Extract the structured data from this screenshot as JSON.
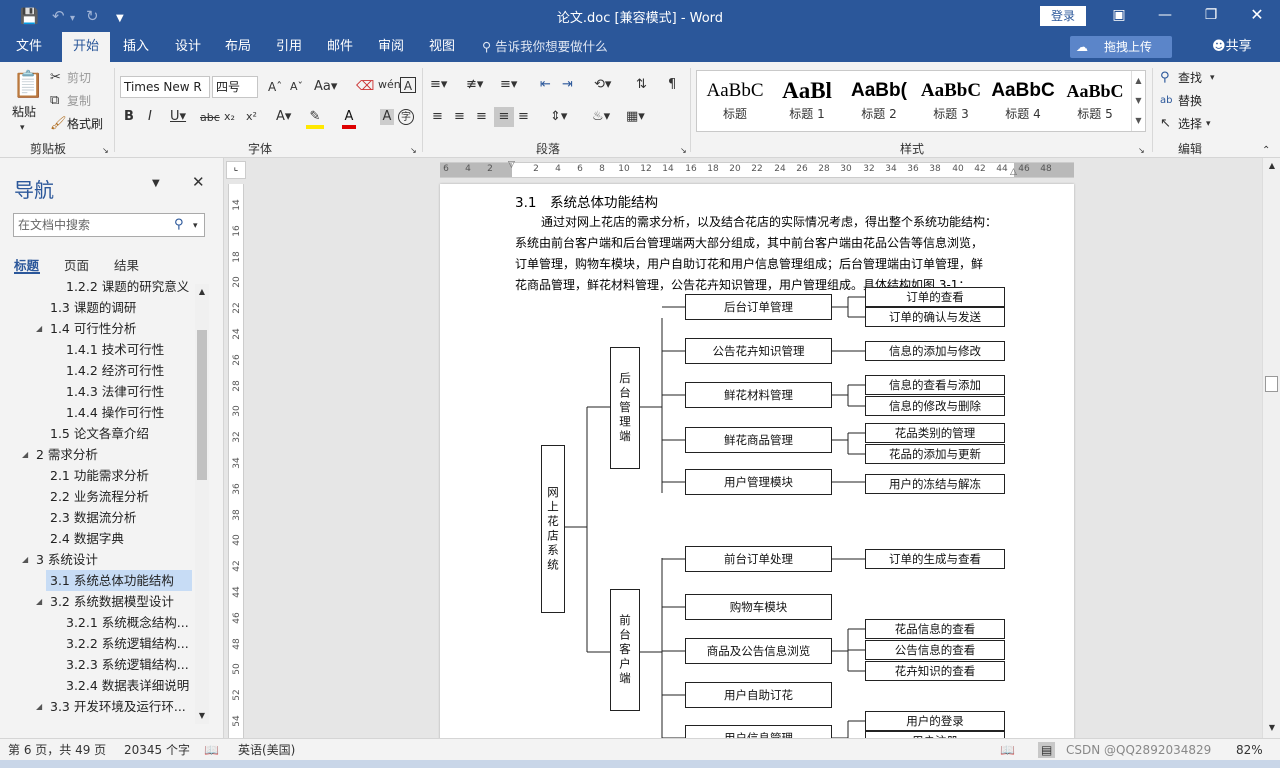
{
  "titlebar": {
    "doc_title": "论文.doc [兼容模式] - Word",
    "save_icon": "save-icon",
    "undo_icon": "undo-icon",
    "redo_icon": "redo-icon",
    "login_label": "登录"
  },
  "tabs": [
    "文件",
    "开始",
    "插入",
    "设计",
    "布局",
    "引用",
    "邮件",
    "审阅",
    "视图"
  ],
  "active_tab": "开始",
  "tell_me": "告诉我你想要做什么",
  "upload_label": "拖拽上传",
  "share_label": "共享",
  "ribbon": {
    "clipboard": {
      "paste": "粘贴",
      "cut": "剪切",
      "copy": "复制",
      "format_painter": "格式刷",
      "label": "剪贴板"
    },
    "font": {
      "name": "Times New R",
      "size": "四号",
      "label": "字体"
    },
    "paragraph": {
      "label": "段落"
    },
    "styles": {
      "label": "样式",
      "items": [
        {
          "preview": "AaBbC",
          "name": "标题"
        },
        {
          "preview": "AaBl",
          "name": "标题 1"
        },
        {
          "preview": "AaBb(",
          "name": "标题 2"
        },
        {
          "preview": "AaBbC",
          "name": "标题 3"
        },
        {
          "preview": "AaBbC",
          "name": "标题 4"
        },
        {
          "preview": "AaBbC",
          "name": "标题 5"
        }
      ]
    },
    "editing": {
      "find": "查找",
      "replace": "替换",
      "select": "选择",
      "label": "编辑"
    }
  },
  "nav": {
    "title": "导航",
    "search_placeholder": "在文档中搜索",
    "tabs": [
      "标题",
      "页面",
      "结果"
    ],
    "items": [
      {
        "num": "1.2.2",
        "text": "课题的研究意义",
        "level": 3,
        "tri": false
      },
      {
        "num": "1.3",
        "text": "课题的调研",
        "level": 2,
        "tri": false
      },
      {
        "num": "1.4",
        "text": "可行性分析",
        "level": 2,
        "tri": true
      },
      {
        "num": "1.4.1",
        "text": "技术可行性",
        "level": 3,
        "tri": false
      },
      {
        "num": "1.4.2",
        "text": "经济可行性",
        "level": 3,
        "tri": false
      },
      {
        "num": "1.4.3",
        "text": "法律可行性",
        "level": 3,
        "tri": false
      },
      {
        "num": "1.4.4",
        "text": "操作可行性",
        "level": 3,
        "tri": false
      },
      {
        "num": "1.5",
        "text": "论文各章介绍",
        "level": 2,
        "tri": false
      },
      {
        "num": "2",
        "text": "需求分析",
        "level": 1,
        "tri": true
      },
      {
        "num": "2.1",
        "text": "功能需求分析",
        "level": 2,
        "tri": false
      },
      {
        "num": "2.2",
        "text": "业务流程分析",
        "level": 2,
        "tri": false
      },
      {
        "num": "2.3",
        "text": "数据流分析",
        "level": 2,
        "tri": false
      },
      {
        "num": "2.4",
        "text": "数据字典",
        "level": 2,
        "tri": false
      },
      {
        "num": "3",
        "text": "系统设计",
        "level": 1,
        "tri": true
      },
      {
        "num": "3.1",
        "text": "系统总体功能结构",
        "level": 2,
        "tri": false,
        "selected": true
      },
      {
        "num": "3.2",
        "text": "系统数据模型设计",
        "level": 2,
        "tri": true
      },
      {
        "num": "3.2.1",
        "text": "系统概念结构...",
        "level": 3,
        "tri": false
      },
      {
        "num": "3.2.2",
        "text": "系统逻辑结构...",
        "level": 3,
        "tri": false
      },
      {
        "num": "3.2.3",
        "text": "系统逻辑结构...",
        "level": 3,
        "tri": false
      },
      {
        "num": "3.2.4",
        "text": "数据表详细说明",
        "level": 3,
        "tri": false
      },
      {
        "num": "3.3",
        "text": "开发环境及运行环...",
        "level": 2,
        "tri": true
      }
    ]
  },
  "ruler": {
    "h_ticks": [
      "6",
      "4",
      "2",
      "2",
      "4",
      "6",
      "8",
      "10",
      "12",
      "14",
      "16",
      "18",
      "20",
      "22",
      "24",
      "26",
      "28",
      "30",
      "32",
      "34",
      "36",
      "38",
      "40",
      "42",
      "44",
      "46",
      "48"
    ],
    "v_ticks": [
      "14",
      "16",
      "18",
      "20",
      "22",
      "24",
      "26",
      "28",
      "30",
      "32",
      "34",
      "36",
      "38",
      "40",
      "42",
      "44",
      "46",
      "48",
      "50",
      "52",
      "54"
    ]
  },
  "document": {
    "section_title": "3.1　系统总体功能结构",
    "paragraph_lines": [
      "通过对网上花店的需求分析，以及结合花店的实际情况考虑，得出整个系统功能结构：",
      "系统由前台客户端和后台管理端两大部分组成，其中前台客户端由花品公告等信息浏览，",
      "订单管理，购物车模块，用户自助订花和用户信息管理组成；后台管理端由订单管理，鲜",
      "花商品管理，鲜花材料管理，公告花卉知识管理，用户管理组成。具体结构如图 3-1："
    ],
    "diagram": {
      "root": "网上花店系统",
      "backend": "后台管理端",
      "frontend": "前台客户端",
      "backend_modules": [
        "后台订单管理",
        "公告花卉知识管理",
        "鲜花材料管理",
        "鲜花商品管理",
        "用户管理模块"
      ],
      "backend_leaves": [
        "订单的查看",
        "订单的确认与发送",
        "信息的添加与修改",
        "信息的查看与添加",
        "信息的修改与删除",
        "花品类别的管理",
        "花品的添加与更新",
        "用户的冻结与解冻"
      ],
      "frontend_modules": [
        "前台订单处理",
        "购物车模块",
        "商品及公告信息浏览",
        "用户自助订花",
        "用户信息管理"
      ],
      "frontend_leaves": [
        "订单的生成与查看",
        "花品信息的查看",
        "公告信息的查看",
        "花卉知识的查看",
        "用户的登录",
        "用户注册"
      ]
    }
  },
  "statusbar": {
    "page": "第 6 页，共 49 页",
    "words": "20345 个字",
    "language": "英语(美国)",
    "zoom": "82%",
    "watermark": "CSDN @QQ2892034829"
  }
}
